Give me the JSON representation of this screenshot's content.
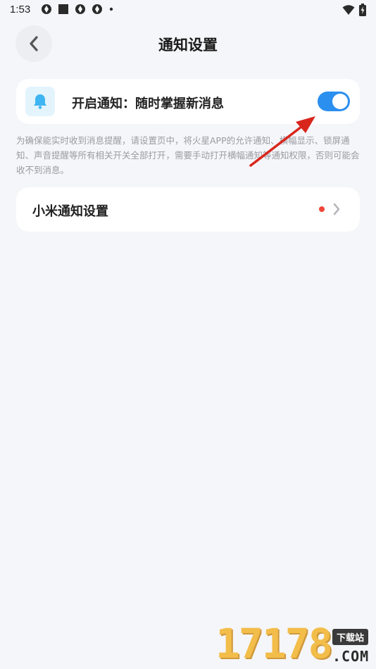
{
  "status_bar": {
    "time": "1:53",
    "left_icons": [
      "aperture-icon",
      "square-icon",
      "aperture-icon",
      "aperture-icon",
      "dot-icon"
    ],
    "right_icons": [
      "wifi-icon",
      "battery-charging-icon"
    ]
  },
  "header": {
    "title": "通知设置",
    "back_icon": "chevron-left-icon"
  },
  "notify_card": {
    "icon": "bell-icon",
    "label": "开启通知：随时掌握新消息",
    "toggle_on": true,
    "accent_color": "#2b8ff0"
  },
  "hint": {
    "text": "为确保能实时收到消息提醒，请设置页中，将火星APP的允许通知、横幅显示、锁屏通知、声音提醒等所有相关开关全部打开，需要手动打开横幅通知等通知权限，否则可能会收不到消息。"
  },
  "xiaomi_card": {
    "label": "小米通知设置",
    "badge_color": "#f0453a",
    "chevron_icon": "chevron-right-icon"
  },
  "watermark": {
    "digits": "17178",
    "badge": "下载站",
    "suffix": ".COM"
  }
}
